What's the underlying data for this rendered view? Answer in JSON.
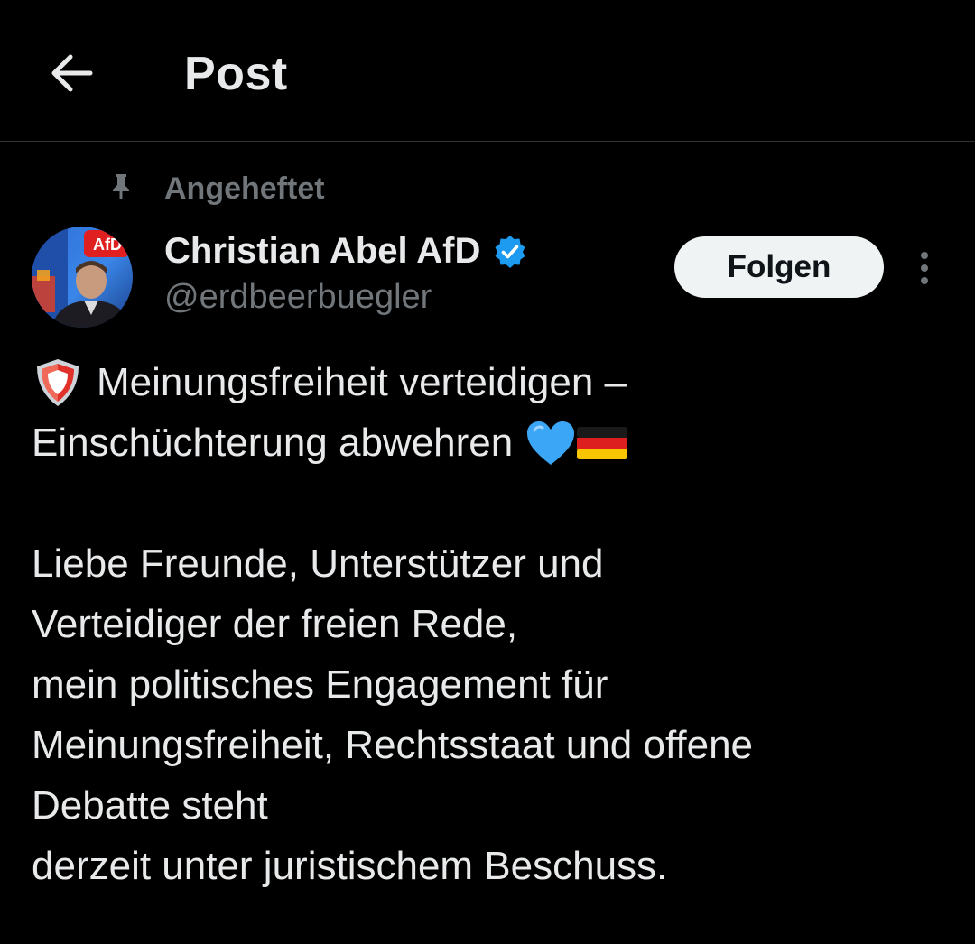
{
  "header": {
    "back_icon": "arrow-left-icon",
    "title": "Post"
  },
  "pinned": {
    "icon": "pin-icon",
    "label": "Angeheftet"
  },
  "author": {
    "name": "Christian Abel AfD",
    "handle": "@erdbeerbuegler",
    "verified": true,
    "avatar_badge": "AfD"
  },
  "actions": {
    "follow_label": "Folgen",
    "more_icon": "more-vertical-icon"
  },
  "post": {
    "line1_text": "Meinungsfreiheit verteidigen –",
    "line2_text": "Einschüchterung abwehren",
    "paragraph_lines": [
      "Liebe Freunde, Unterstützer und",
      "Verteidiger der freien Rede,",
      "mein politisches Engagement für",
      "Meinungsfreiheit, Rechtsstaat und offene",
      "Debatte steht",
      "derzeit unter juristischem Beschuss."
    ]
  },
  "colors": {
    "background": "#000000",
    "text_primary": "#e7e9ea",
    "text_secondary": "#71767b",
    "verified_blue": "#1d9bf0",
    "follow_bg": "#eff3f4"
  }
}
